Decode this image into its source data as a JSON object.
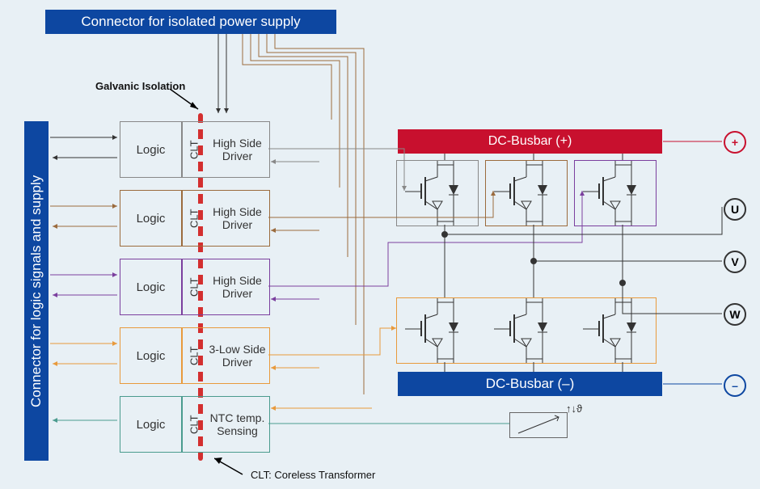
{
  "top_connector": "Connector for isolated power supply",
  "left_connector": "Connector for logic signals and supply",
  "galvanic_label": "Galvanic Isolation",
  "clt_note": "CLT: Coreless Transformer",
  "busbar_pos": "DC-Busbar (+)",
  "busbar_neg": "DC-Busbar (–)",
  "blocks": [
    {
      "logic": "Logic",
      "clt": "CLT",
      "drv": "High Side Driver"
    },
    {
      "logic": "Logic",
      "clt": "CLT",
      "drv": "High Side Driver"
    },
    {
      "logic": "Logic",
      "clt": "CLT",
      "drv": "High Side Driver"
    },
    {
      "logic": "Logic",
      "clt": "CLT",
      "drv": "3-Low Side Driver"
    },
    {
      "logic": "Logic",
      "clt": "CLT",
      "drv": "NTC temp. Sensing"
    }
  ],
  "phases": {
    "u": "U",
    "v": "V",
    "w": "W"
  },
  "plus": "+",
  "minus": "–"
}
